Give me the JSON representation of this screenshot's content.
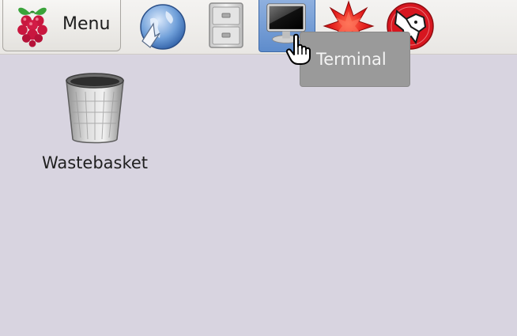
{
  "taskbar": {
    "menu_label": "Menu",
    "launchers": [
      {
        "icon": "globe-browser-icon"
      },
      {
        "icon": "filing-cabinet-icon"
      },
      {
        "icon": "terminal-icon",
        "active": true
      },
      {
        "icon": "mathematica-star-icon"
      },
      {
        "icon": "wolfram-wolf-icon"
      }
    ]
  },
  "tooltip": {
    "text": "Terminal"
  },
  "desktop": {
    "icons": [
      {
        "label": "Wastebasket",
        "icon": "wastebasket-icon"
      }
    ]
  },
  "colors": {
    "desktop_background": "#d8d4e0",
    "taskbar_background": "#eeece9",
    "tooltip_background": "#9a9a9a",
    "terminal_highlight": "#6b96d3"
  }
}
